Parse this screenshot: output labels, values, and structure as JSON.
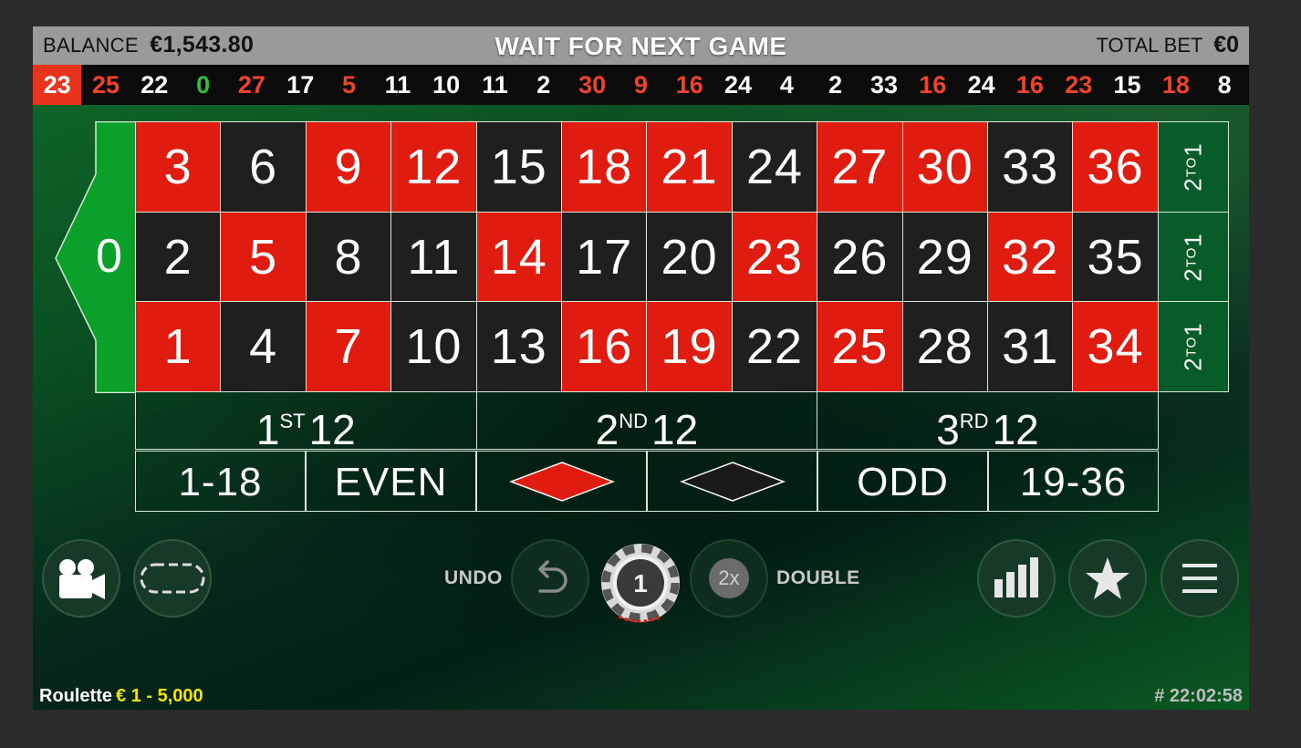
{
  "topbar": {
    "balance_label": "BALANCE",
    "balance_value": "€1,543.80",
    "status": "WAIT FOR NEXT GAME",
    "total_bet_label": "TOTAL BET",
    "total_bet_value": "€0"
  },
  "history": [
    {
      "n": "23",
      "color": "red",
      "latest": true
    },
    {
      "n": "25",
      "color": "red"
    },
    {
      "n": "22",
      "color": "black"
    },
    {
      "n": "0",
      "color": "green"
    },
    {
      "n": "27",
      "color": "red"
    },
    {
      "n": "17",
      "color": "black"
    },
    {
      "n": "5",
      "color": "red"
    },
    {
      "n": "11",
      "color": "black"
    },
    {
      "n": "10",
      "color": "black"
    },
    {
      "n": "11",
      "color": "black"
    },
    {
      "n": "2",
      "color": "black"
    },
    {
      "n": "30",
      "color": "red"
    },
    {
      "n": "9",
      "color": "red"
    },
    {
      "n": "16",
      "color": "red"
    },
    {
      "n": "24",
      "color": "black"
    },
    {
      "n": "4",
      "color": "black"
    },
    {
      "n": "2",
      "color": "black"
    },
    {
      "n": "33",
      "color": "black"
    },
    {
      "n": "16",
      "color": "red"
    },
    {
      "n": "24",
      "color": "black"
    },
    {
      "n": "16",
      "color": "red"
    },
    {
      "n": "23",
      "color": "red"
    },
    {
      "n": "15",
      "color": "black"
    },
    {
      "n": "18",
      "color": "red"
    },
    {
      "n": "8",
      "color": "black"
    }
  ],
  "board": {
    "zero": "0",
    "rows": [
      [
        {
          "n": "3",
          "c": "red"
        },
        {
          "n": "6",
          "c": "black"
        },
        {
          "n": "9",
          "c": "red"
        },
        {
          "n": "12",
          "c": "red"
        },
        {
          "n": "15",
          "c": "black"
        },
        {
          "n": "18",
          "c": "red"
        },
        {
          "n": "21",
          "c": "red"
        },
        {
          "n": "24",
          "c": "black"
        },
        {
          "n": "27",
          "c": "red"
        },
        {
          "n": "30",
          "c": "red"
        },
        {
          "n": "33",
          "c": "black"
        },
        {
          "n": "36",
          "c": "red"
        }
      ],
      [
        {
          "n": "2",
          "c": "black"
        },
        {
          "n": "5",
          "c": "red"
        },
        {
          "n": "8",
          "c": "black"
        },
        {
          "n": "11",
          "c": "black"
        },
        {
          "n": "14",
          "c": "red"
        },
        {
          "n": "17",
          "c": "black"
        },
        {
          "n": "20",
          "c": "black"
        },
        {
          "n": "23",
          "c": "red"
        },
        {
          "n": "26",
          "c": "black"
        },
        {
          "n": "29",
          "c": "black"
        },
        {
          "n": "32",
          "c": "red"
        },
        {
          "n": "35",
          "c": "black"
        }
      ],
      [
        {
          "n": "1",
          "c": "red"
        },
        {
          "n": "4",
          "c": "black"
        },
        {
          "n": "7",
          "c": "red"
        },
        {
          "n": "10",
          "c": "black"
        },
        {
          "n": "13",
          "c": "black"
        },
        {
          "n": "16",
          "c": "red"
        },
        {
          "n": "19",
          "c": "red"
        },
        {
          "n": "22",
          "c": "black"
        },
        {
          "n": "25",
          "c": "red"
        },
        {
          "n": "28",
          "c": "black"
        },
        {
          "n": "31",
          "c": "black"
        },
        {
          "n": "34",
          "c": "red"
        }
      ]
    ],
    "column_bet": {
      "a": "2",
      "b": "TO",
      "c": "1"
    },
    "dozens": [
      {
        "num": "1",
        "sup": "ST",
        "rest": "12"
      },
      {
        "num": "2",
        "sup": "ND",
        "rest": "12"
      },
      {
        "num": "3",
        "sup": "RD",
        "rest": "12"
      }
    ],
    "outside": {
      "low": "1-18",
      "even": "EVEN",
      "odd": "ODD",
      "high": "19-36"
    }
  },
  "controls": {
    "undo_label": "UNDO",
    "double_label": "DOUBLE",
    "double_icon_text": "2x",
    "chip_value": "1"
  },
  "footer": {
    "game_name": "Roulette",
    "limits": "€ 1 - 5,000",
    "round_id": "# 22:02:58"
  },
  "colors": {
    "red": "#e01c10",
    "black": "#1f1f1f",
    "green": "#0aa02a",
    "history_latest_bg": "#e8331d",
    "limits_yellow": "#f5e400"
  }
}
